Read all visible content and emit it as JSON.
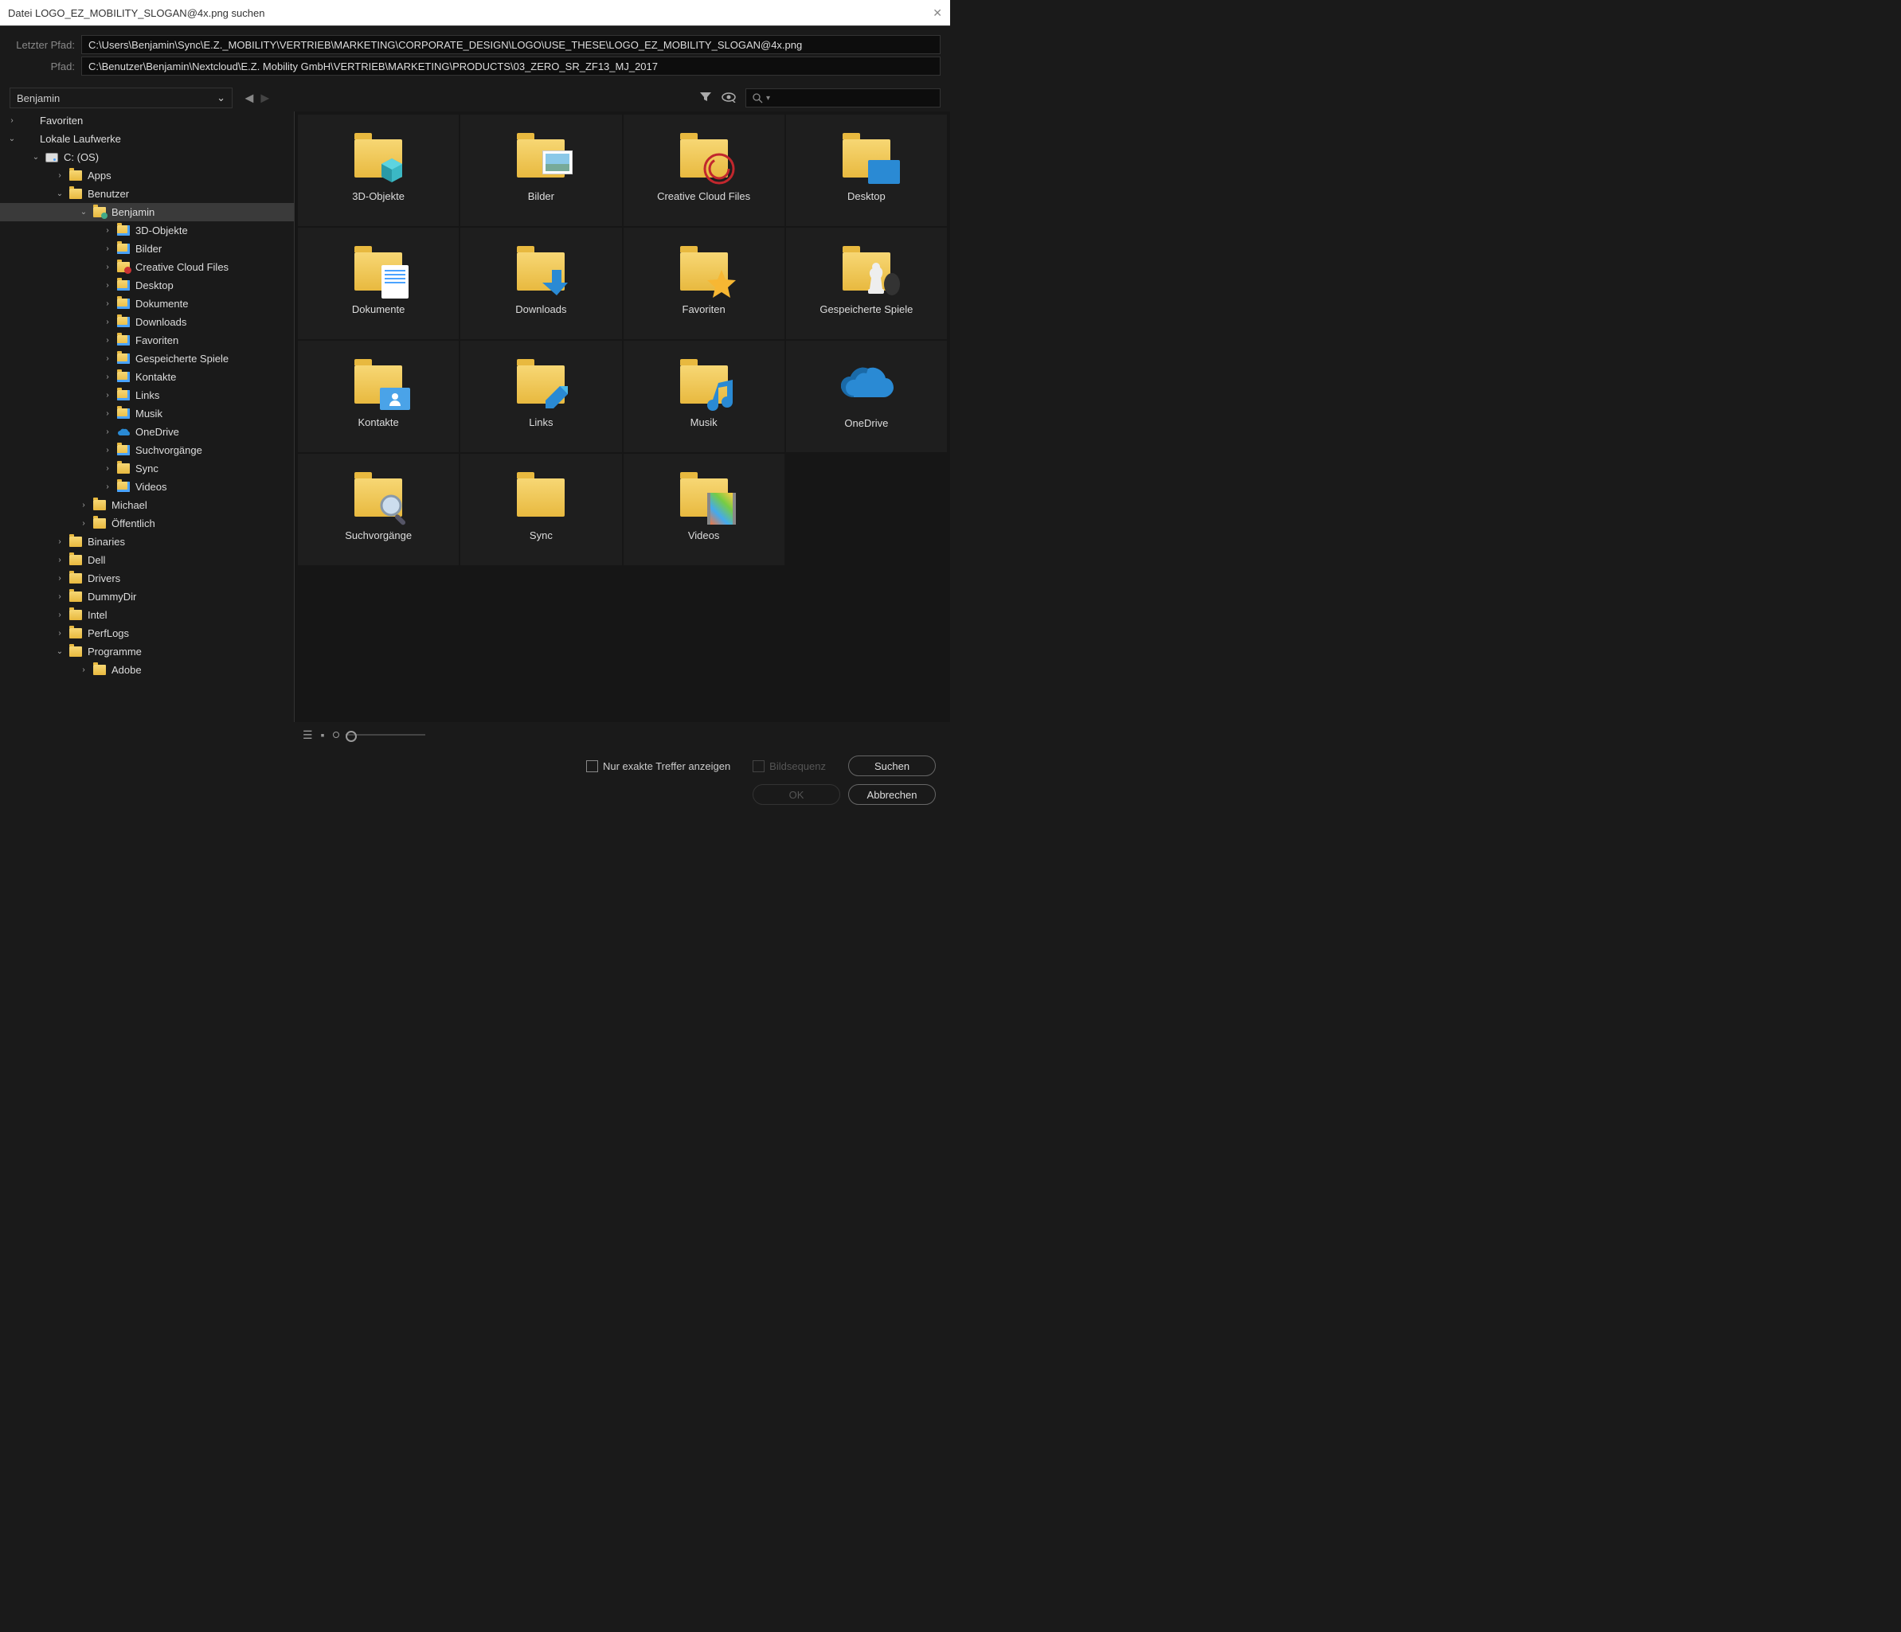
{
  "title": "Datei LOGO_EZ_MOBILITY_SLOGAN@4x.png suchen",
  "labels": {
    "lastPath": "Letzter Pfad:",
    "path": "Pfad:"
  },
  "paths": {
    "last": "C:\\Users\\Benjamin\\Sync\\E.Z._MOBILITY\\VERTRIEB\\MARKETING\\CORPORATE_DESIGN\\LOGO\\USE_THESE\\LOGO_EZ_MOBILITY_SLOGAN@4x.png",
    "current": "C:\\Benutzer\\Benjamin\\Nextcloud\\E.Z. Mobility GmbH\\VERTRIEB\\MARKETING\\PRODUCTS\\03_ZERO_SR_ZF13_MJ_2017"
  },
  "breadcrumb": "Benjamin",
  "tree": [
    {
      "lvl": 0,
      "tw": ">",
      "ic": "none",
      "lbl": "Favoriten"
    },
    {
      "lvl": 0,
      "tw": "v",
      "ic": "none",
      "lbl": "Lokale Laufwerke"
    },
    {
      "lvl": 1,
      "tw": "v",
      "ic": "drive",
      "lbl": "C: (OS)"
    },
    {
      "lvl": 2,
      "tw": ">",
      "ic": "folder",
      "lbl": "Apps"
    },
    {
      "lvl": 2,
      "tw": "v",
      "ic": "folder",
      "lbl": "Benutzer"
    },
    {
      "lvl": 3,
      "tw": "v",
      "ic": "folder-user",
      "lbl": "Benjamin",
      "sel": true
    },
    {
      "lvl": 4,
      "tw": ">",
      "ic": "folder-ov",
      "lbl": "3D-Objekte"
    },
    {
      "lvl": 4,
      "tw": ">",
      "ic": "folder-ov",
      "lbl": "Bilder"
    },
    {
      "lvl": 4,
      "tw": ">",
      "ic": "folder-cc",
      "lbl": "Creative Cloud Files"
    },
    {
      "lvl": 4,
      "tw": ">",
      "ic": "folder-ov",
      "lbl": "Desktop"
    },
    {
      "lvl": 4,
      "tw": ">",
      "ic": "folder-ov",
      "lbl": "Dokumente"
    },
    {
      "lvl": 4,
      "tw": ">",
      "ic": "folder-ov",
      "lbl": "Downloads"
    },
    {
      "lvl": 4,
      "tw": ">",
      "ic": "folder-ov",
      "lbl": "Favoriten"
    },
    {
      "lvl": 4,
      "tw": ">",
      "ic": "folder-ov",
      "lbl": "Gespeicherte Spiele"
    },
    {
      "lvl": 4,
      "tw": ">",
      "ic": "folder-ov",
      "lbl": "Kontakte"
    },
    {
      "lvl": 4,
      "tw": ">",
      "ic": "folder-ov",
      "lbl": "Links"
    },
    {
      "lvl": 4,
      "tw": ">",
      "ic": "folder-ov",
      "lbl": "Musik"
    },
    {
      "lvl": 4,
      "tw": ">",
      "ic": "onedrive",
      "lbl": "OneDrive"
    },
    {
      "lvl": 4,
      "tw": ">",
      "ic": "folder-ov",
      "lbl": "Suchvorgänge"
    },
    {
      "lvl": 4,
      "tw": ">",
      "ic": "folder",
      "lbl": "Sync"
    },
    {
      "lvl": 4,
      "tw": ">",
      "ic": "folder-ov",
      "lbl": "Videos"
    },
    {
      "lvl": 3,
      "tw": ">",
      "ic": "folder",
      "lbl": "Michael"
    },
    {
      "lvl": 3,
      "tw": ">",
      "ic": "folder",
      "lbl": "Öffentlich"
    },
    {
      "lvl": 2,
      "tw": ">",
      "ic": "folder",
      "lbl": "Binaries"
    },
    {
      "lvl": 2,
      "tw": ">",
      "ic": "folder",
      "lbl": "Dell"
    },
    {
      "lvl": 2,
      "tw": ">",
      "ic": "folder",
      "lbl": "Drivers"
    },
    {
      "lvl": 2,
      "tw": ">",
      "ic": "folder",
      "lbl": "DummyDir"
    },
    {
      "lvl": 2,
      "tw": ">",
      "ic": "folder",
      "lbl": "Intel"
    },
    {
      "lvl": 2,
      "tw": ">",
      "ic": "folder",
      "lbl": "PerfLogs"
    },
    {
      "lvl": 2,
      "tw": "v",
      "ic": "folder",
      "lbl": "Programme"
    },
    {
      "lvl": 3,
      "tw": ">",
      "ic": "folder",
      "lbl": "Adobe"
    }
  ],
  "folders": [
    {
      "name": "3D-Objekte",
      "ov": "cube"
    },
    {
      "name": "Bilder",
      "ov": "photo"
    },
    {
      "name": "Creative Cloud Files",
      "ov": "cc"
    },
    {
      "name": "Desktop",
      "ov": "desk"
    },
    {
      "name": "Dokumente",
      "ov": "doc"
    },
    {
      "name": "Downloads",
      "ov": "dl"
    },
    {
      "name": "Favoriten",
      "ov": "star"
    },
    {
      "name": "Gespeicherte Spiele",
      "ov": "chess"
    },
    {
      "name": "Kontakte",
      "ov": "contact"
    },
    {
      "name": "Links",
      "ov": "link"
    },
    {
      "name": "Musik",
      "ov": "music"
    },
    {
      "name": "OneDrive",
      "ov": "cloud"
    },
    {
      "name": "Suchvorgänge",
      "ov": "search"
    },
    {
      "name": "Sync",
      "ov": ""
    },
    {
      "name": "Videos",
      "ov": "video"
    }
  ],
  "options": {
    "exact": "Nur exakte Treffer anzeigen",
    "seq": "Bildsequenz"
  },
  "buttons": {
    "search": "Suchen",
    "ok": "OK",
    "cancel": "Abbrechen"
  }
}
